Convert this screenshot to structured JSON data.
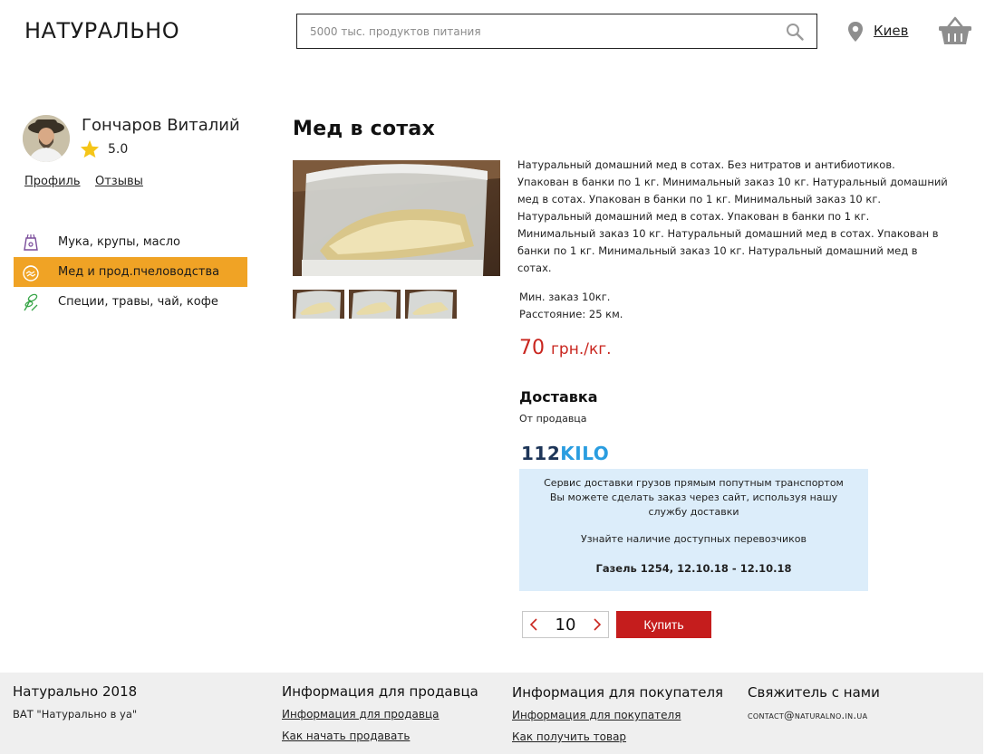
{
  "header": {
    "logo": "НАТУРАЛЬНО",
    "search_placeholder": "5000 тыс. продуктов питания",
    "city": "Киев"
  },
  "seller": {
    "name": "Гончаров Виталий",
    "rating": "5.0",
    "profile_link": "Профиль",
    "reviews_link": "Отзывы"
  },
  "categories": [
    {
      "label": "Мука, крупы, масло",
      "icon": "flour-bag-icon"
    },
    {
      "label": "Мед и прод.пчеловодства",
      "icon": "honey-pot-icon",
      "active": true
    },
    {
      "label": "Специи, травы, чай, кофе",
      "icon": "herbs-icon"
    }
  ],
  "product": {
    "title": "Мед в сотах",
    "description": "Натуральный домашний мед в сотах. Без нитратов и антибиотиков. Упакован в банки по 1 кг. Минимальный заказ 10 кг. Натуральный домашний мед в сотах. Упакован в банки по 1 кг. Минимальный заказ 10 кг. Натуральный домашний мед в сотах. Упакован в банки по 1 кг. Минимальный заказ 10 кг. Натуральный домашний мед в сотах. Упакован в банки по 1 кг. Минимальный заказ 10 кг. Натуральный домашний мед в сотах.",
    "min_order": "Мин. заказ 10кг.",
    "distance": "Расстояние: 25 км.",
    "price": "70",
    "price_unit": "грн./кг."
  },
  "delivery": {
    "title": "Доставка",
    "from": "От продавца",
    "service_logo_num": "112",
    "service_logo_text": "KILO",
    "box_line1": "Сервис доставки грузов прямым попутным транспортом",
    "box_line2": "Вы можете сделать заказ через сайт, используя нашу",
    "box_line3": "службу доставки",
    "box_line4": "Узнайте наличие доступных перевозчиков",
    "box_line5": "Газель 1254, 12.10.18 - 12.10.18"
  },
  "order": {
    "quantity": "10",
    "buy_label": "Купить"
  },
  "footer": {
    "brand": "Натурально 2018",
    "brand_sub": "ВАТ \"Натурально в уа\"",
    "seller_head": "Информация для продавца",
    "seller_link1": "Информация для продавца",
    "seller_link2": "Как начать продавать",
    "buyer_head": "Информация для покупателя",
    "buyer_link1": "Информация для покупателя",
    "buyer_link2": "Как получить товар",
    "contact_head": "Свяжитель с нами",
    "contact_email": "contact@naturalno.in.ua"
  },
  "colors": {
    "accent_orange": "#f0a325",
    "price_red": "#c9251e",
    "buy_red": "#c51d1d",
    "delivery_box": "#dcedfa",
    "footer_bg": "#efefef"
  }
}
